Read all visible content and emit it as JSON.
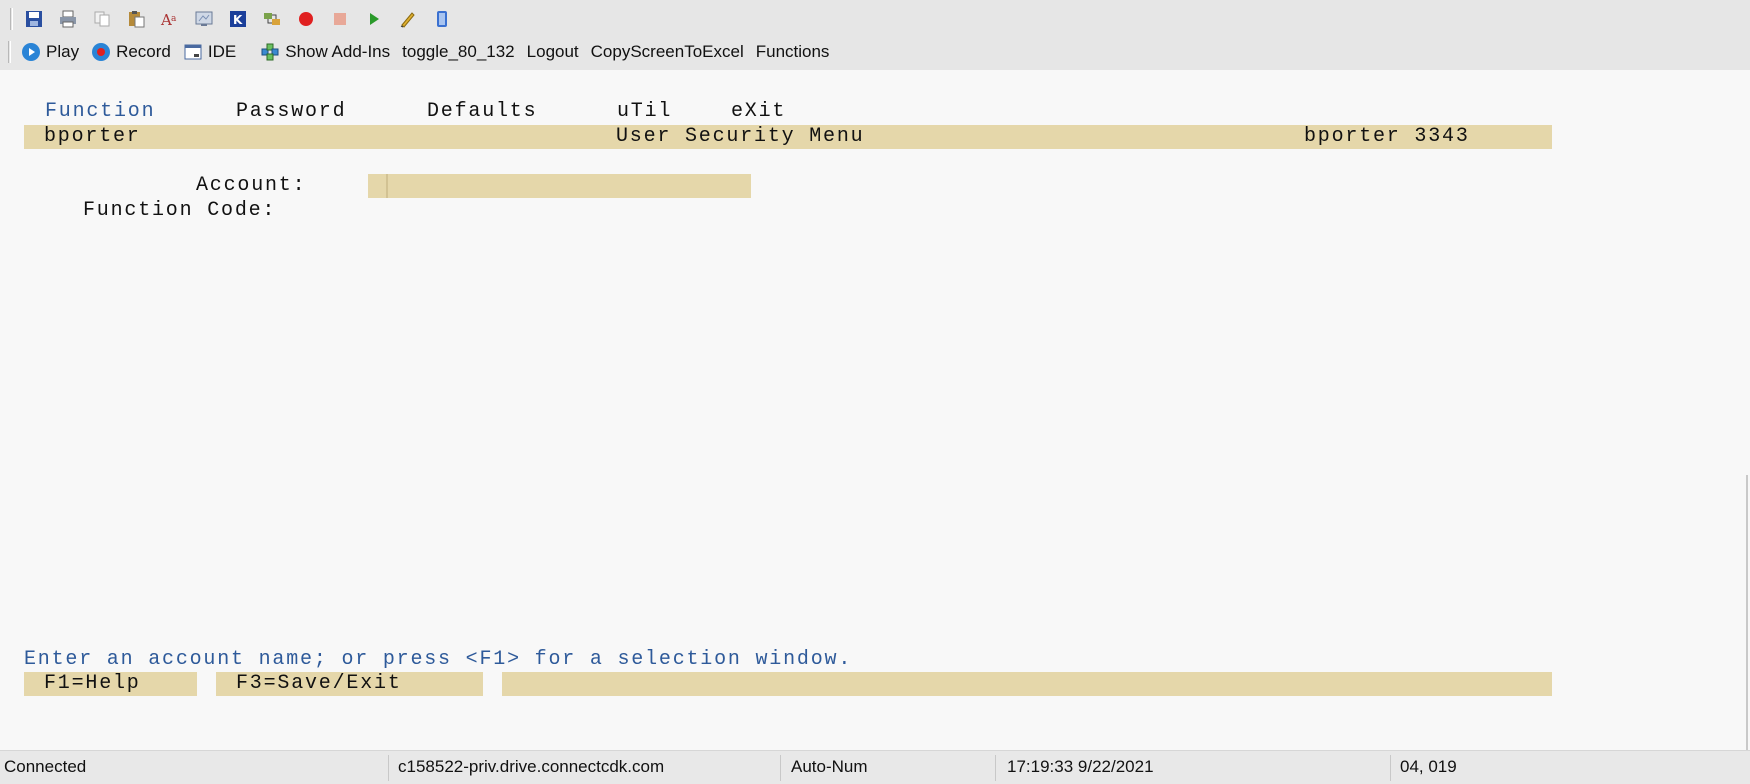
{
  "toolbar": {
    "icons": [
      "save-icon",
      "print-icon",
      "copy-icon",
      "paste-icon",
      "font-icon",
      "screen-icon",
      "map-icon",
      "connect-icon",
      "record-dot-icon",
      "stop-icon",
      "play-icon",
      "edit-icon",
      "clipboard-icon"
    ],
    "buttons": {
      "play": "Play",
      "record": "Record",
      "ide": "IDE",
      "show_addins": "Show Add-Ins",
      "toggle": "toggle_80_132",
      "logout": "Logout",
      "copy_screen": "CopyScreenToExcel",
      "functions": "Functions"
    }
  },
  "terminal": {
    "menu": {
      "function": "Function",
      "password": "Password",
      "defaults": "Defaults",
      "util": "uTil",
      "exit": "eXit"
    },
    "title_bar": {
      "user": "bporter",
      "title": "User Security Menu",
      "user_id": "bporter 3343"
    },
    "fields": {
      "account_label": "Account:",
      "account_value": "",
      "function_code_label": "Function Code:"
    },
    "prompt": "Enter an account name; or press <F1> for a selection window.",
    "fkeys": {
      "f1": "F1=Help",
      "f3": "F3=Save/Exit"
    }
  },
  "status": {
    "connection": "Connected",
    "host": "c158522-priv.drive.connectcdk.com",
    "mode": "Auto-Num",
    "datetime": "17:19:33  9/22/2021",
    "cursor_pos": "04, 019"
  },
  "colors": {
    "highlight_bg": "#e5d7aa",
    "accent_blue": "#2e5a9a",
    "toolbar_bg": "#e6e6e6"
  }
}
